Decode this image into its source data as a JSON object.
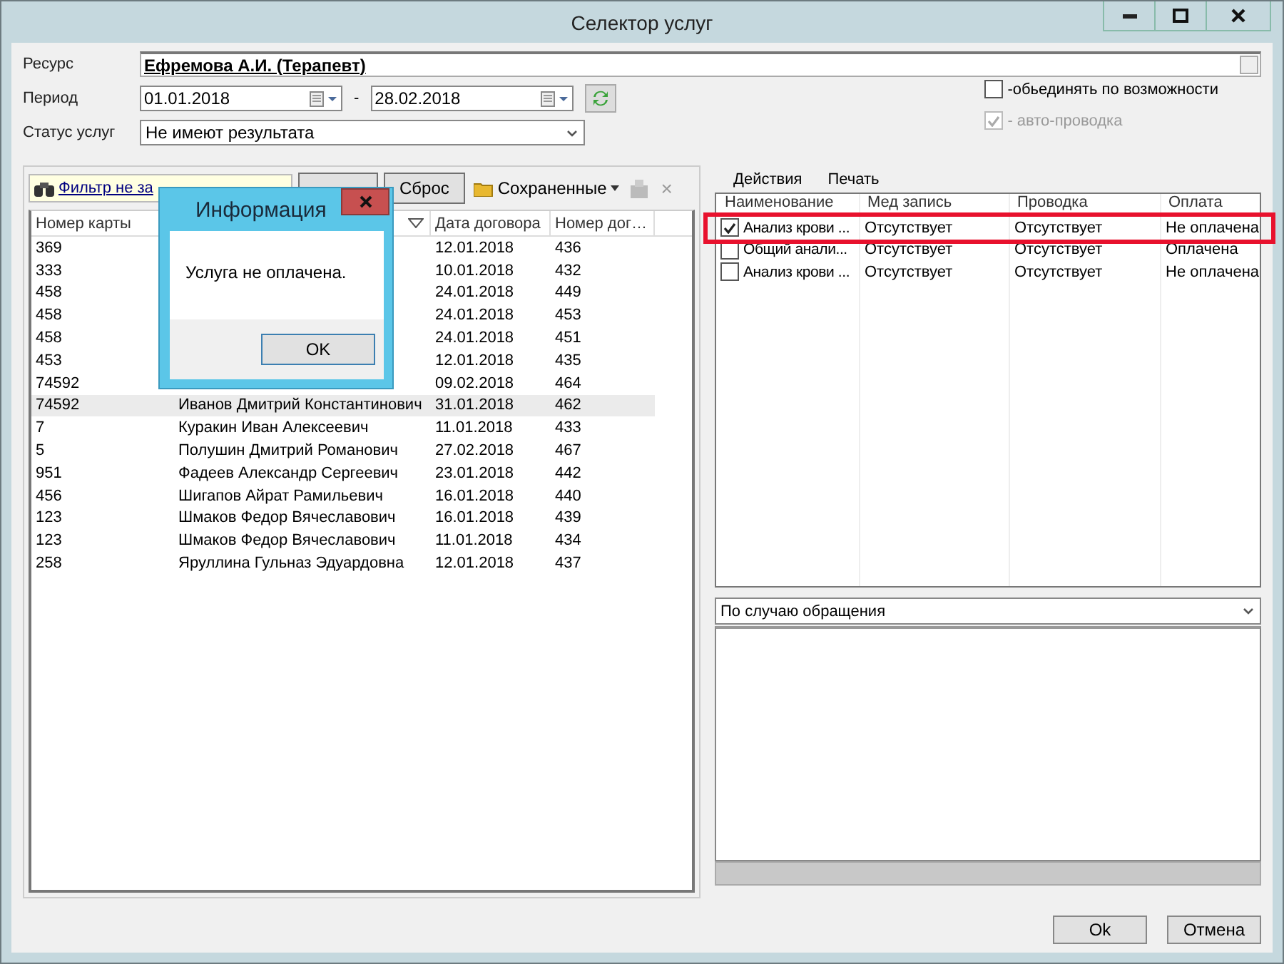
{
  "window": {
    "title": "Селектор услуг"
  },
  "form": {
    "resource": {
      "label": "Ресурс",
      "value": "Ефремова А.И. (Терапевт)"
    },
    "period": {
      "label": "Период",
      "from": "01.01.2018",
      "separator": "-",
      "to": "28.02.2018"
    },
    "status": {
      "label": "Статус услуг",
      "value": "Не имеют результата"
    },
    "options": [
      {
        "label": "-обьединять по возможности",
        "checked": false,
        "disabled": false
      },
      {
        "label": "- авто-проводка",
        "checked": true,
        "disabled": true
      }
    ]
  },
  "left": {
    "filter": "Фильтр не за",
    "reset": "Сброс",
    "saved": "Сохраненные",
    "close": "×",
    "columns": [
      {
        "label": "Номер карты"
      },
      {
        "sorted": true
      },
      {
        "label": "Дата договора"
      },
      {
        "label": "Номер дог…"
      }
    ],
    "rows": [
      {
        "card": "369",
        "date": "12.01.2018",
        "number": "436",
        "selected": false
      },
      {
        "card": "333",
        "date": "10.01.2018",
        "number": "432",
        "selected": false
      },
      {
        "card": "458",
        "date": "24.01.2018",
        "number": "449",
        "selected": false
      },
      {
        "card": "458",
        "date": "24.01.2018",
        "number": "453",
        "selected": false
      },
      {
        "card": "458",
        "date": "24.01.2018",
        "number": "451",
        "selected": false
      },
      {
        "card": "453",
        "date": "12.01.2018",
        "number": "435",
        "selected": false
      },
      {
        "card": "74592",
        "date": "09.02.2018",
        "number": "464",
        "selected": false
      },
      {
        "card": "74592",
        "name": "Иванов Дмитрий Константинович",
        "date": "31.01.2018",
        "number": "462",
        "selected": true
      },
      {
        "card": "7",
        "name": "Куракин Иван Алексеевич",
        "date": "11.01.2018",
        "number": "433",
        "selected": false
      },
      {
        "card": "5",
        "name": "Полушин Дмитрий Романович",
        "date": "27.02.2018",
        "number": "467",
        "selected": false
      },
      {
        "card": "951",
        "name": "Фадеев Александр Сергеевич",
        "date": "23.01.2018",
        "number": "442",
        "selected": false
      },
      {
        "card": "456",
        "name": "Шигапов Айрат Рамильевич",
        "date": "16.01.2018",
        "number": "440",
        "selected": false
      },
      {
        "card": "123",
        "name": "Шмаков Федор Вячеславович",
        "date": "16.01.2018",
        "number": "439",
        "selected": false
      },
      {
        "card": "123",
        "name": "Шмаков Федор Вячеславович",
        "date": "11.01.2018",
        "number": "434",
        "selected": false
      },
      {
        "card": "258",
        "name": "Яруллина Гульназ Эдуардовна",
        "date": "12.01.2018",
        "number": "437",
        "selected": false
      }
    ]
  },
  "right": {
    "menu": [
      "Действия",
      "Печать"
    ],
    "columns": [
      "Наименование",
      "Мед запись",
      "Проводка",
      "Оплата"
    ],
    "rows": [
      {
        "name": "Анализ крови ...",
        "checked": true,
        "record": "Отсутствует",
        "posting": "Отсутствует",
        "payment": "Не оплачена",
        "highlighted": true
      },
      {
        "name": "Общий анали...",
        "checked": false,
        "record": "Отсутствует",
        "posting": "Отсутствует",
        "payment": "Оплачена",
        "highlighted": false
      },
      {
        "name": "Анализ крови ...",
        "checked": false,
        "record": "Отсутствует",
        "posting": "Отсутствует",
        "payment": "Не оплачена",
        "highlighted": false
      }
    ],
    "case": "По случаю обращения"
  },
  "buttons": [
    "Ok",
    "Отмена"
  ],
  "dialog": {
    "title": "Информация",
    "message": "Услуга не оплачена.",
    "button": "OK"
  }
}
